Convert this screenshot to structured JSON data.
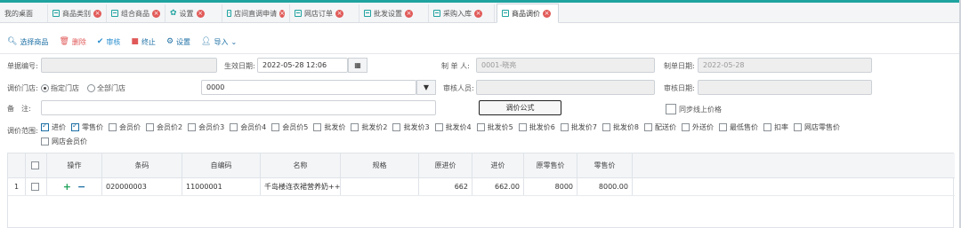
{
  "tabs": [
    {
      "label": "我的桌面"
    },
    {
      "label": "商品类别"
    },
    {
      "label": "组合商品"
    },
    {
      "label": "设置"
    },
    {
      "label": "店间直调申请"
    },
    {
      "label": "网店订单"
    },
    {
      "label": "批发设置"
    },
    {
      "label": "采购入库"
    },
    {
      "label": "商品调价"
    }
  ],
  "toolbar": {
    "select_goods": "选择商品",
    "delete": "删除",
    "audit": "审核",
    "stop": "终止",
    "settings": "设置",
    "import": "导入"
  },
  "form": {
    "doc_no_label": "单据编号:",
    "doc_no_value": "",
    "effective_label": "生效日期:",
    "effective_value": "2022-05-28 12:06",
    "maker_label": "制 单 人:",
    "maker_value": "0001-晓亮",
    "make_date_label": "制单日期:",
    "make_date_value": "2022-05-28",
    "store_label": "调价门店:",
    "radio_specified": "指定门店",
    "radio_all": "全部门店",
    "store_value": "0000",
    "auditor_label": "审核人员:",
    "auditor_value": "",
    "audit_date_label": "审核日期:",
    "audit_date_value": "",
    "remark_label": "备　注:",
    "remark_value": "",
    "formula_button": "调价公式",
    "sync_label": "同步线上价格",
    "range_label": "调价范围:"
  },
  "price_types": [
    {
      "label": "进价",
      "checked": true
    },
    {
      "label": "零售价",
      "checked": true
    },
    {
      "label": "会员价",
      "checked": false
    },
    {
      "label": "会员价2",
      "checked": false
    },
    {
      "label": "会员价3",
      "checked": false
    },
    {
      "label": "会员价4",
      "checked": false
    },
    {
      "label": "会员价5",
      "checked": false
    },
    {
      "label": "批发价",
      "checked": false
    },
    {
      "label": "批发价2",
      "checked": false
    },
    {
      "label": "批发价3",
      "checked": false
    },
    {
      "label": "批发价4",
      "checked": false
    },
    {
      "label": "批发价5",
      "checked": false
    },
    {
      "label": "批发价6",
      "checked": false
    },
    {
      "label": "批发价7",
      "checked": false
    },
    {
      "label": "批发价8",
      "checked": false
    },
    {
      "label": "配送价",
      "checked": false
    },
    {
      "label": "外送价",
      "checked": false
    },
    {
      "label": "最低售价",
      "checked": false
    },
    {
      "label": "扣率",
      "checked": false
    },
    {
      "label": "网店零售价",
      "checked": false
    },
    {
      "label": "网店会员价",
      "checked": false
    }
  ],
  "table": {
    "headers": [
      "操作",
      "条码",
      "自编码",
      "名称",
      "规格",
      "原进价",
      "进价",
      "原零售价",
      "零售价"
    ],
    "rows": [
      {
        "index": "1",
        "barcode": "020000003",
        "code": "11000001",
        "name": "千岛楼连衣裙营养奶++",
        "spec": "",
        "orig_cost": "662",
        "cost": "662.00",
        "orig_retail": "8000",
        "retail": "8000.00"
      }
    ]
  },
  "colors": {
    "accent": "#1fa3a0",
    "close": "#e15b59",
    "link": "#1c6fa4"
  }
}
